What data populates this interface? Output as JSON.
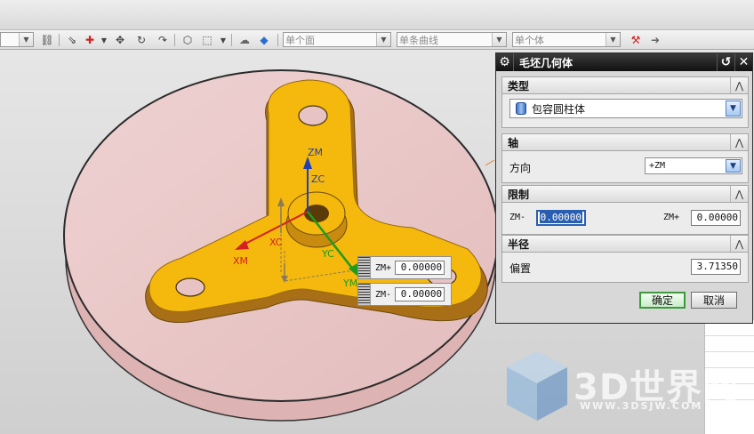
{
  "toolbar": {
    "combo_face": "单个面",
    "combo_curve": "单条曲线",
    "combo_body": "单个体"
  },
  "viewport": {
    "axes": {
      "zm": "ZM",
      "zc": "ZC",
      "xc": "XC",
      "yc": "YC",
      "xm": "XM",
      "ym": "YM"
    },
    "handles": [
      {
        "label": "ZM+",
        "value": "0.00000"
      },
      {
        "label": "ZM-",
        "value": "0.00000"
      }
    ]
  },
  "watermark": {
    "text": "3D世界网",
    "url": "WWW.3DSJW.COM"
  },
  "dialog": {
    "title": "毛坯几何体",
    "sections": {
      "type": {
        "heading": "类型",
        "value": "包容圆柱体"
      },
      "axis": {
        "heading": "轴",
        "direction_label": "方向",
        "direction_value": "+ZM"
      },
      "limits": {
        "heading": "限制",
        "zm_minus_label": "ZM-",
        "zm_minus_value": "0.00000",
        "zm_plus_label": "ZM+",
        "zm_plus_value": "0.00000"
      },
      "radius": {
        "heading": "半径",
        "offset_label": "偏置",
        "offset_value": "3.71350"
      }
    },
    "ok_label": "确定",
    "cancel_label": "取消"
  },
  "colors": {
    "part": "#f5b80c",
    "part_side": "#a86f16",
    "stock_top": "#e9c6c6",
    "axis_z": "#1f3fb8",
    "axis_x": "#d42020",
    "axis_y": "#1f9a1f",
    "dialog_title": "#1a1a1a"
  }
}
